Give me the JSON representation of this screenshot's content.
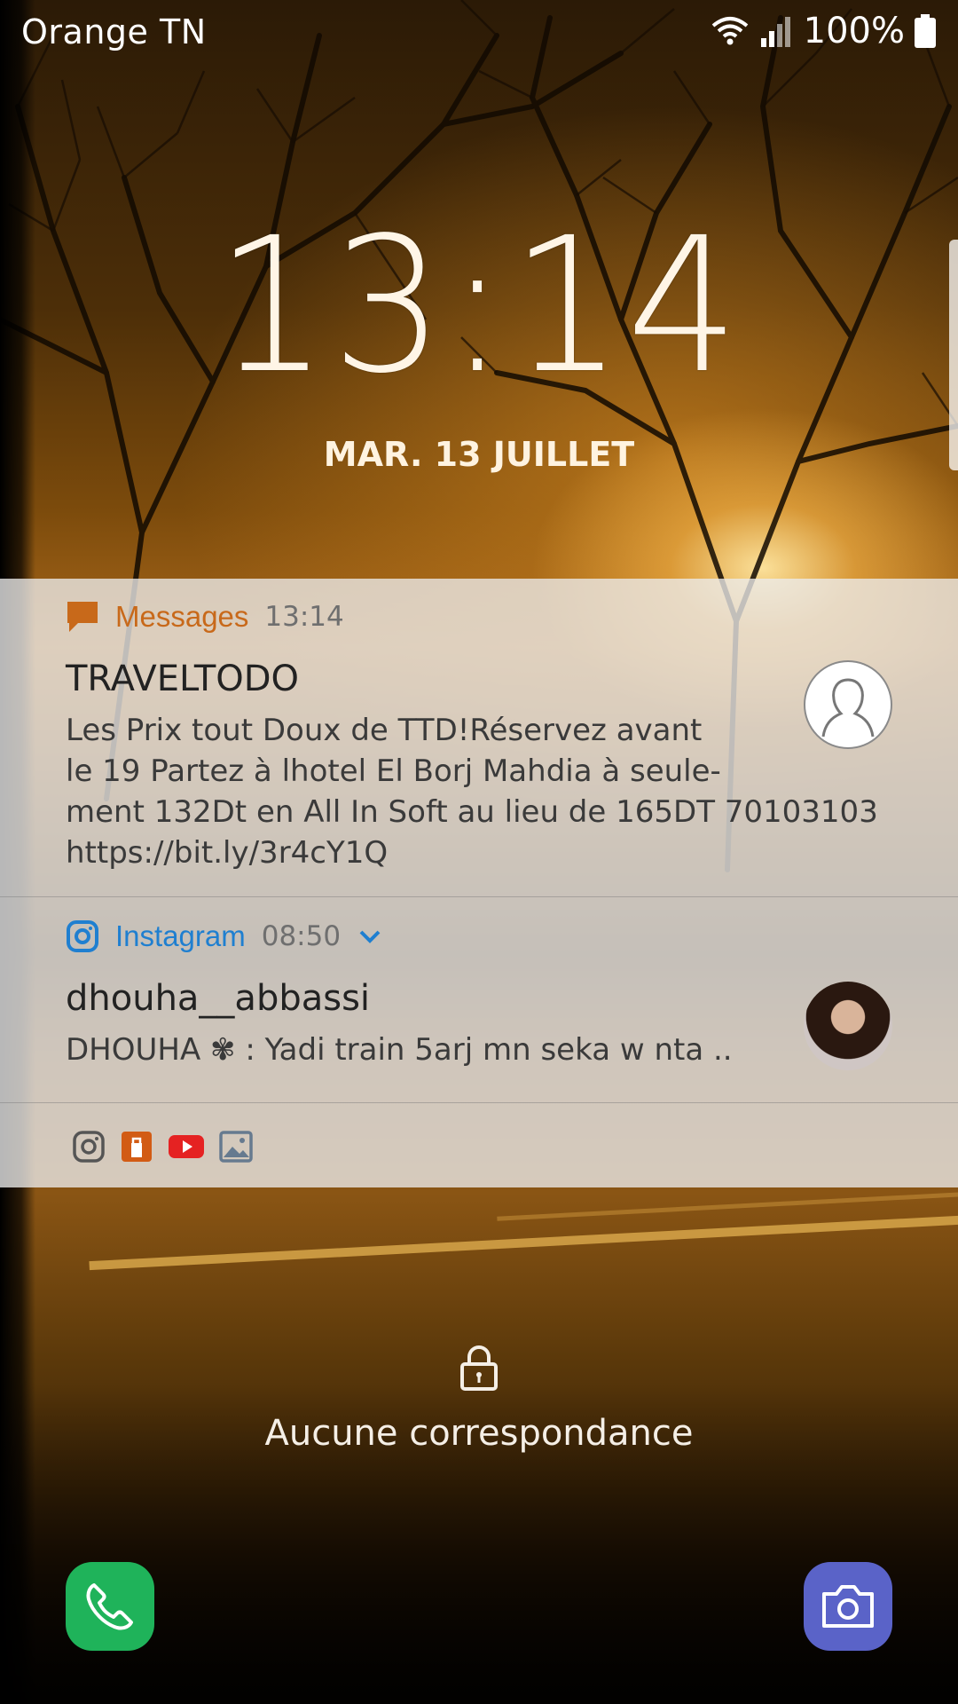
{
  "status_bar": {
    "carrier": "Orange TN",
    "battery_percent": "100%",
    "icons": [
      "wifi-icon",
      "signal-icon",
      "battery-icon"
    ]
  },
  "lock_clock": {
    "time": "13:14",
    "date": "MAR. 13 JUILLET"
  },
  "notifications": [
    {
      "app": "Messages",
      "time": "13:14",
      "title": "TRAVELTODO",
      "body_lines": [
        "Les Prix tout Doux de TTD!Réservez avant",
        "le 19 Partez à lhotel El Borj Mahdia à seule-",
        "ment 132Dt en All In Soft au lieu de 165DT 70103103",
        "https://bit.ly/3r4cY1Q"
      ],
      "accent_color": "#c8691a",
      "icon": "message-icon",
      "avatar": "default-contact-avatar"
    },
    {
      "app": "Instagram",
      "time": "08:50",
      "title": "dhouha__abbassi",
      "body": "DHOUHA ✾ : Yadi train 5arj mn seka w nta ..",
      "accent_color": "#1f7fd0",
      "icon": "instagram-icon",
      "expand_icon": "chevron-down-icon",
      "avatar": "user-photo-avatar"
    }
  ],
  "app_tray_icons": [
    "instagram-icon",
    "store-bag-icon",
    "youtube-icon",
    "gallery-icon"
  ],
  "unlock": {
    "message": "Aucune correspondance",
    "icon": "lock-icon"
  },
  "shortcuts": {
    "left": "phone-icon",
    "right": "camera-icon"
  }
}
